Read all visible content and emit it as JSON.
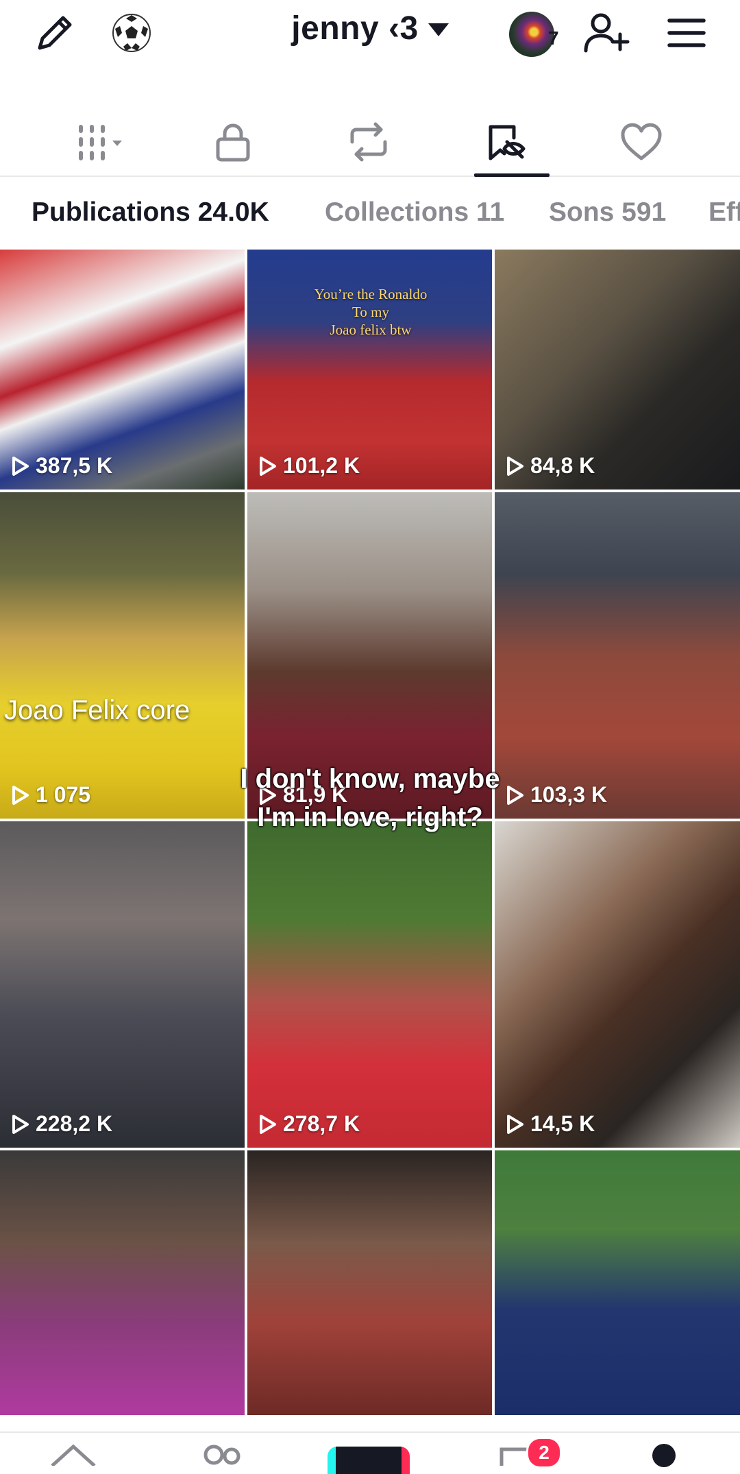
{
  "header": {
    "username": "jenny ‹3",
    "story_count": "7"
  },
  "tabs": [
    {
      "name": "videos",
      "icon": "grid-icon"
    },
    {
      "name": "private",
      "icon": "lock-icon"
    },
    {
      "name": "reposts",
      "icon": "repost-icon"
    },
    {
      "name": "favorites",
      "icon": "bookmark-hidden-icon",
      "active": true
    },
    {
      "name": "liked",
      "icon": "heart-icon"
    }
  ],
  "subtabs": {
    "publications": "Publications 24.0K",
    "collections": "Collections 11",
    "sons": "Sons 591",
    "effects": "Effets"
  },
  "videos": [
    {
      "views": "387,5 K"
    },
    {
      "views": "101,2 K",
      "caption": "You’re the Ronaldo\nTo my\nJoao felix btw"
    },
    {
      "views": "84,8 K"
    },
    {
      "views": "1 075",
      "caption": "Joao Felix core"
    },
    {
      "views": "81,9 K"
    },
    {
      "views": "103,3 K"
    },
    {
      "views": "228,2 K"
    },
    {
      "views": "278,7 K"
    },
    {
      "views": "14,5 K"
    }
  ],
  "overlay_caption": "I don't know, maybe I'm in love, right?",
  "bottom_nav": {
    "inbox_badge": "2"
  },
  "colors": {
    "accent": "#fe2c55",
    "text": "#161823",
    "muted": "#8a8b91"
  }
}
